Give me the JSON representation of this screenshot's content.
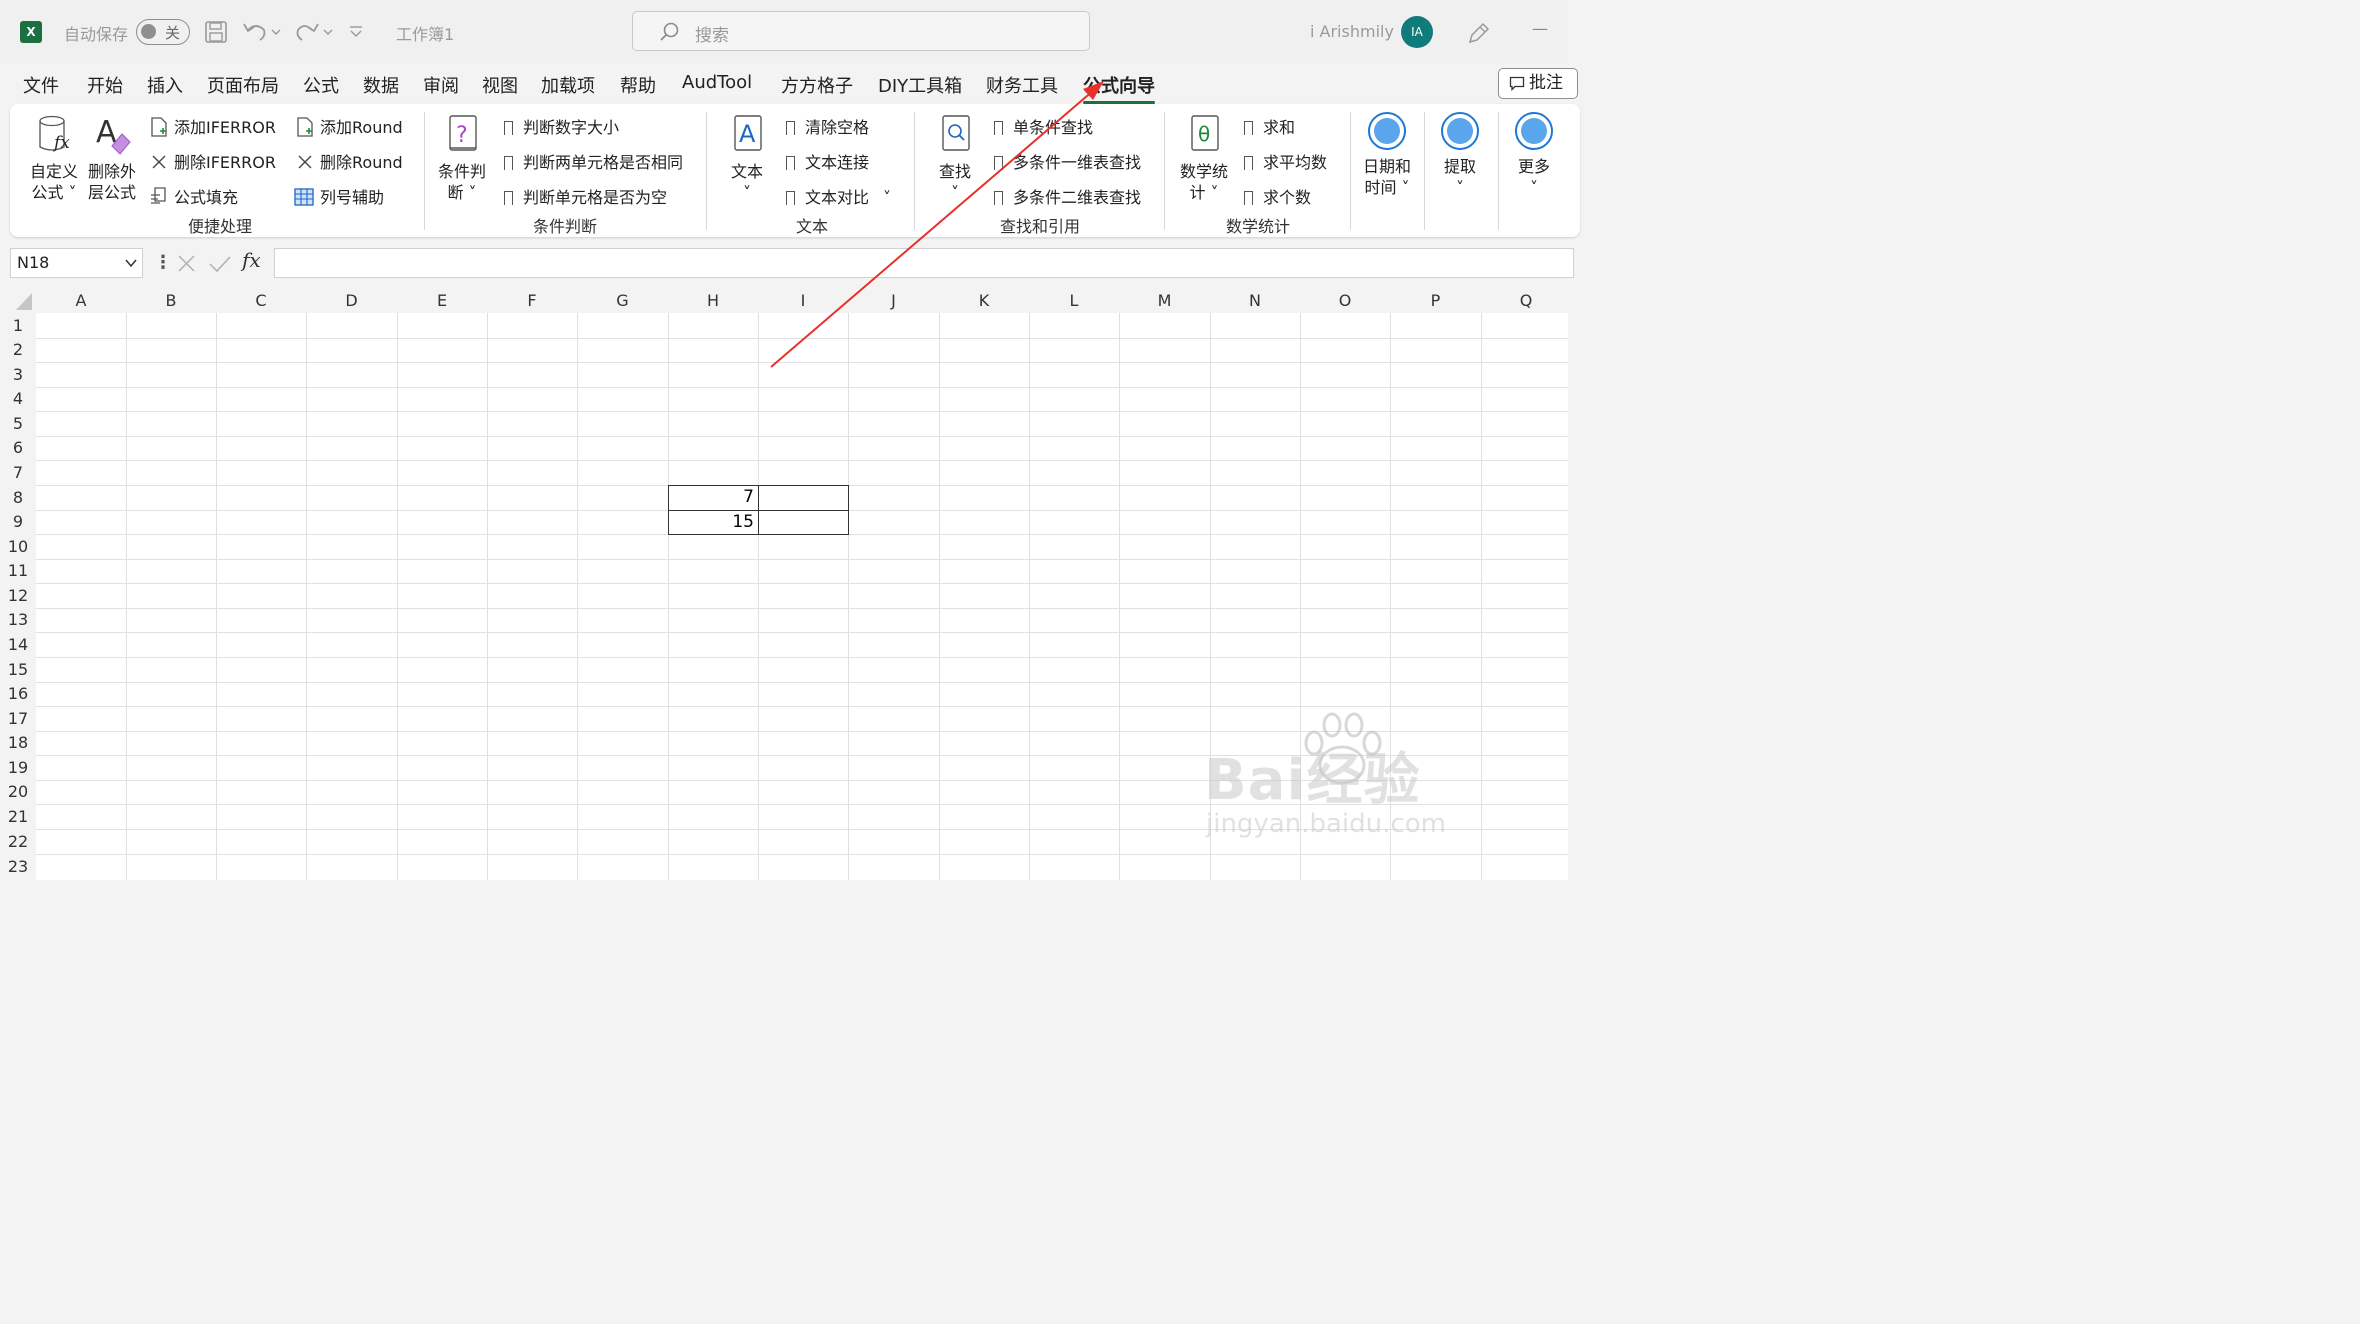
{
  "titlebar": {
    "autosave_label": "自动保存",
    "autosave_state": "关",
    "workbook_name": "工作簿1",
    "search_placeholder": "搜索",
    "user_name": "i Arishmily",
    "user_initials": "IA",
    "minimize": "—"
  },
  "menu": {
    "tabs": [
      "文件",
      "开始",
      "插入",
      "页面布局",
      "公式",
      "数据",
      "审阅",
      "视图",
      "加载项",
      "帮助",
      "AudTool",
      "方方格子",
      "DIY工具箱",
      "财务工具",
      "公式向导"
    ],
    "active_tab": "公式向导",
    "comment_button": "批注"
  },
  "ribbon": {
    "quick": {
      "custom_formula_line1": "自定义",
      "custom_formula_line2": "公式",
      "delete_outer_line1": "删除外",
      "delete_outer_line2": "层公式",
      "add_iferror": "添加IFERROR",
      "del_iferror": "删除IFERROR",
      "formula_fill": "公式填充",
      "add_round": "添加Round",
      "del_round": "删除Round",
      "col_assist": "列号辅助",
      "group": "便捷处理"
    },
    "cond": {
      "big_line1": "条件判",
      "big_line2": "断",
      "item1": "判断数字大小",
      "item2": "判断两单元格是否相同",
      "item3": "判断单元格是否为空",
      "group": "条件判断"
    },
    "text": {
      "big": "文本",
      "item1": "清除空格",
      "item2": "文本连接",
      "item3": "文本对比",
      "group": "文本"
    },
    "lookup": {
      "big": "查找",
      "item1": "单条件查找",
      "item2": "多条件一维表查找",
      "item3": "多条件二维表查找",
      "group": "查找和引用"
    },
    "math": {
      "big_line1": "数学统",
      "big_line2": "计",
      "item1": "求和",
      "item2": "求平均数",
      "item3": "求个数",
      "group": "数学统计"
    },
    "date": {
      "line1": "日期和",
      "line2": "时间"
    },
    "extract": "提取",
    "more": "更多",
    "icon_fx": "fx",
    "icon_text_a": "A",
    "icon_theta": "θ",
    "icon_question": "?"
  },
  "formula_bar": {
    "name_box": "N18",
    "fx_label": "fx",
    "formula": ""
  },
  "sheet": {
    "columns": [
      "A",
      "B",
      "C",
      "D",
      "E",
      "F",
      "G",
      "H",
      "I",
      "J",
      "K",
      "L",
      "M",
      "N",
      "O",
      "P",
      "Q"
    ],
    "rows": [
      "1",
      "2",
      "3",
      "4",
      "5",
      "6",
      "7",
      "8",
      "9",
      "10",
      "11",
      "12",
      "13",
      "14",
      "15",
      "16",
      "17",
      "18",
      "19",
      "20",
      "21",
      "22",
      "23"
    ],
    "cell_h8": "7",
    "cell_h9": "15"
  },
  "watermark": {
    "text": "Bai经验",
    "url": "jingyan.baidu.com"
  },
  "colors": {
    "excel_green": "#1d6f42",
    "annotation_arrow": "#e8302c",
    "avatar": "#0f7b7b",
    "circle_button": "#5aa6ec"
  }
}
